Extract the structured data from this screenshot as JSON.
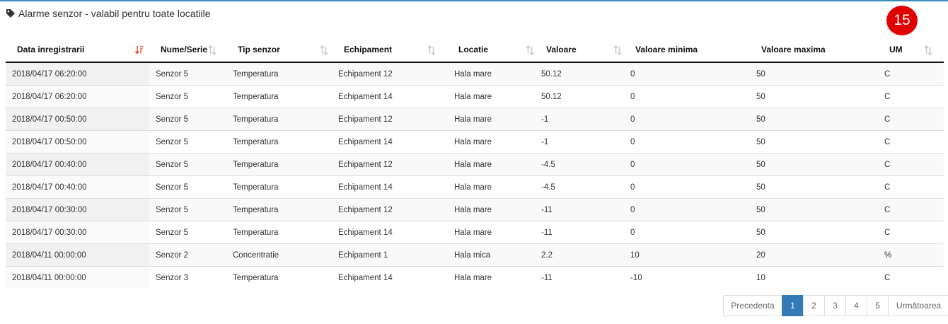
{
  "panel": {
    "title": "Alarme senzor - valabil pentru toate locatiile",
    "badge_count": "15",
    "badge_color": "#e00000"
  },
  "table": {
    "columns": [
      {
        "label": "Data inregistrarii",
        "sort": "desc"
      },
      {
        "label": "Nume/Serie",
        "sort": "both"
      },
      {
        "label": "Tip senzor",
        "sort": "both"
      },
      {
        "label": "Echipament",
        "sort": "both"
      },
      {
        "label": "Locatie",
        "sort": "both"
      },
      {
        "label": "Valoare",
        "sort": "both"
      },
      {
        "label": "Valoare minima",
        "sort": "none"
      },
      {
        "label": "Valoare maxima",
        "sort": "none"
      },
      {
        "label": "UM",
        "sort": "both"
      }
    ],
    "rows": [
      [
        "2018/04/17 06:20:00",
        "Senzor 5",
        "Temperatura",
        "Echipament 12",
        "Hala mare",
        "50.12",
        "0",
        "50",
        "C"
      ],
      [
        "2018/04/17 06:20:00",
        "Senzor 5",
        "Temperatura",
        "Echipament 14",
        "Hala mare",
        "50.12",
        "0",
        "50",
        "C"
      ],
      [
        "2018/04/17 00:50:00",
        "Senzor 5",
        "Temperatura",
        "Echipament 12",
        "Hala mare",
        "-1",
        "0",
        "50",
        "C"
      ],
      [
        "2018/04/17 00:50:00",
        "Senzor 5",
        "Temperatura",
        "Echipament 14",
        "Hala mare",
        "-1",
        "0",
        "50",
        "C"
      ],
      [
        "2018/04/17 00:40:00",
        "Senzor 5",
        "Temperatura",
        "Echipament 12",
        "Hala mare",
        "-4.5",
        "0",
        "50",
        "C"
      ],
      [
        "2018/04/17 00:40:00",
        "Senzor 5",
        "Temperatura",
        "Echipament 14",
        "Hala mare",
        "-4.5",
        "0",
        "50",
        "C"
      ],
      [
        "2018/04/17 00:30:00",
        "Senzor 5",
        "Temperatura",
        "Echipament 12",
        "Hala mare",
        "-11",
        "0",
        "50",
        "C"
      ],
      [
        "2018/04/17 00:30:00",
        "Senzor 5",
        "Temperatura",
        "Echipament 14",
        "Hala mare",
        "-11",
        "0",
        "50",
        "C"
      ],
      [
        "2018/04/11 00:00:00",
        "Senzor 2",
        "Concentratie",
        "Echipament 1",
        "Hala mica",
        "2.2",
        "10",
        "20",
        "%"
      ],
      [
        "2018/04/11 00:00:00",
        "Senzor 3",
        "Temperatura",
        "Echipament 14",
        "Hala mare",
        "-11",
        "-10",
        "10",
        "C"
      ]
    ]
  },
  "pagination": {
    "prev_label": "Precedenta",
    "pages": [
      "1",
      "2",
      "3",
      "4",
      "5"
    ],
    "active_page": "1",
    "next_label": "Următoarea"
  },
  "colors": {
    "sort_active": "#e74c3c",
    "sort_inactive": "#c8c8c8",
    "pagination_active": "#337ab7"
  }
}
